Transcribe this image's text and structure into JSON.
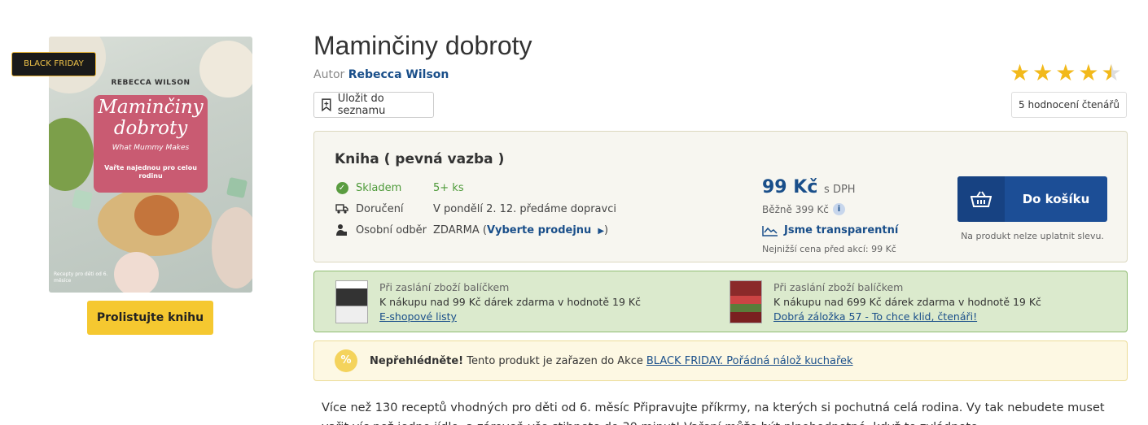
{
  "cover": {
    "author": "REBECCA WILSON",
    "title_line1": "Maminčiny",
    "title_line2": "dobroty",
    "subtitle": "What Mummy Makes",
    "tagline": "Vařte najednou pro celou rodinu",
    "footnote": "Recepty pro děti od 6. měsíce"
  },
  "badge": "BLACK FRIDAY",
  "browse_label": "Prolistujte knihu",
  "product": {
    "title": "Maminčiny dobroty",
    "author_prefix": "Autor",
    "author": "Rebecca Wilson",
    "save_label": "Uložit do seznamu",
    "rating": 4.5,
    "ratings_label": "5 hodnocení čtenářů"
  },
  "buy": {
    "format": "Kniha ( pevná vazba )",
    "stock_label": "Skladem",
    "stock_value": "5+ ks",
    "delivery_label": "Doručení",
    "delivery_value": "V pondělí 2. 12. předáme dopravci",
    "pickup_label": "Osobní odběr",
    "pickup_value_prefix": "ZDARMA (",
    "pickup_link": "Vyberte prodejnu",
    "pickup_value_suffix": ")",
    "price": "99 Kč",
    "price_suffix": "s DPH",
    "regular": "Běžně 399 Kč",
    "transparent": "Jsme transparentní",
    "lowest": "Nejnižší cena před akcí: 99 Kč",
    "cart_label": "Do košíku",
    "no_discount": "Na produkt nelze uplatnit slevu.",
    "accent": "#1c4e96"
  },
  "gifts": [
    {
      "line1": "Při zaslání zboží balíčkem",
      "line2": "K nákupu nad 99 Kč dárek zdarma v hodnotě 19 Kč",
      "link": "E-shopové listy"
    },
    {
      "line1": "Při zaslání zboží balíčkem",
      "line2": "K nákupu nad 699 Kč dárek zdarma v hodnotě 19 Kč",
      "link": "Dobrá záložka 57 - To chce klid, čtenáři!"
    }
  ],
  "promo": {
    "icon": "%",
    "bold": "Nepřehlédněte!",
    "text": "Tento produkt je zařazen do Akce",
    "link": "BLACK FRIDAY. Pořádná nálož kuchařek"
  },
  "description": "Více než 130 receptů vhodných pro děti od 6. měsíc Připravujte příkrmy, na kterých si pochutná celá rodina. Vy tak nebudete muset vařit víc než jedno jídlo, a zároveň vše stihnete do 30 minut! Vaření může být plnohodnotné, když to zvládnete."
}
